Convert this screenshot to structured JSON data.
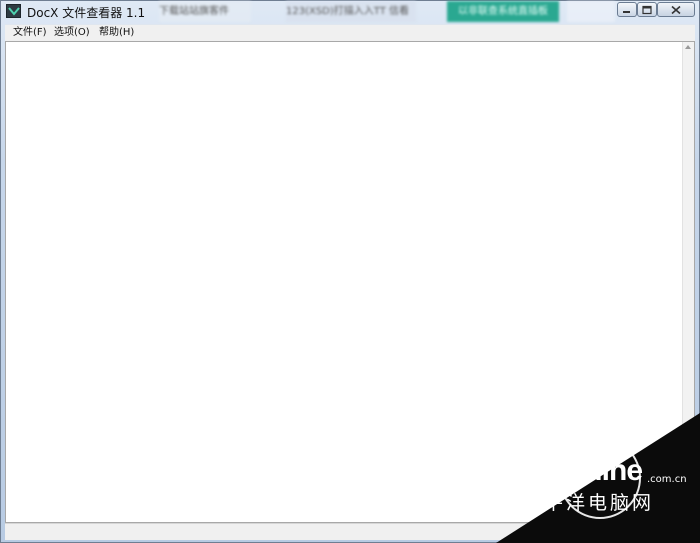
{
  "window": {
    "title": "DocX 文件查看器 1.1",
    "background_blur_texts": [
      "下载站站旗客件",
      "123(XSD)打描入入TT 信看",
      "以非联查系统直插板",
      ""
    ],
    "controls": {
      "minimize_icon": "minimize-icon",
      "maximize_icon": "maximize-icon",
      "close_icon": "close-icon"
    }
  },
  "menu": {
    "items": [
      {
        "label": "文件(F)"
      },
      {
        "label": "选项(O)"
      },
      {
        "label": "帮助(H)"
      }
    ]
  },
  "watermark": {
    "brand": "PConline",
    "domain": ".com.cn",
    "chinese": "太平洋电脑网"
  },
  "colors": {
    "accent_green": "#2aa891",
    "watermark_dark": "#0b0b0b",
    "client_bg": "#ffffff"
  }
}
